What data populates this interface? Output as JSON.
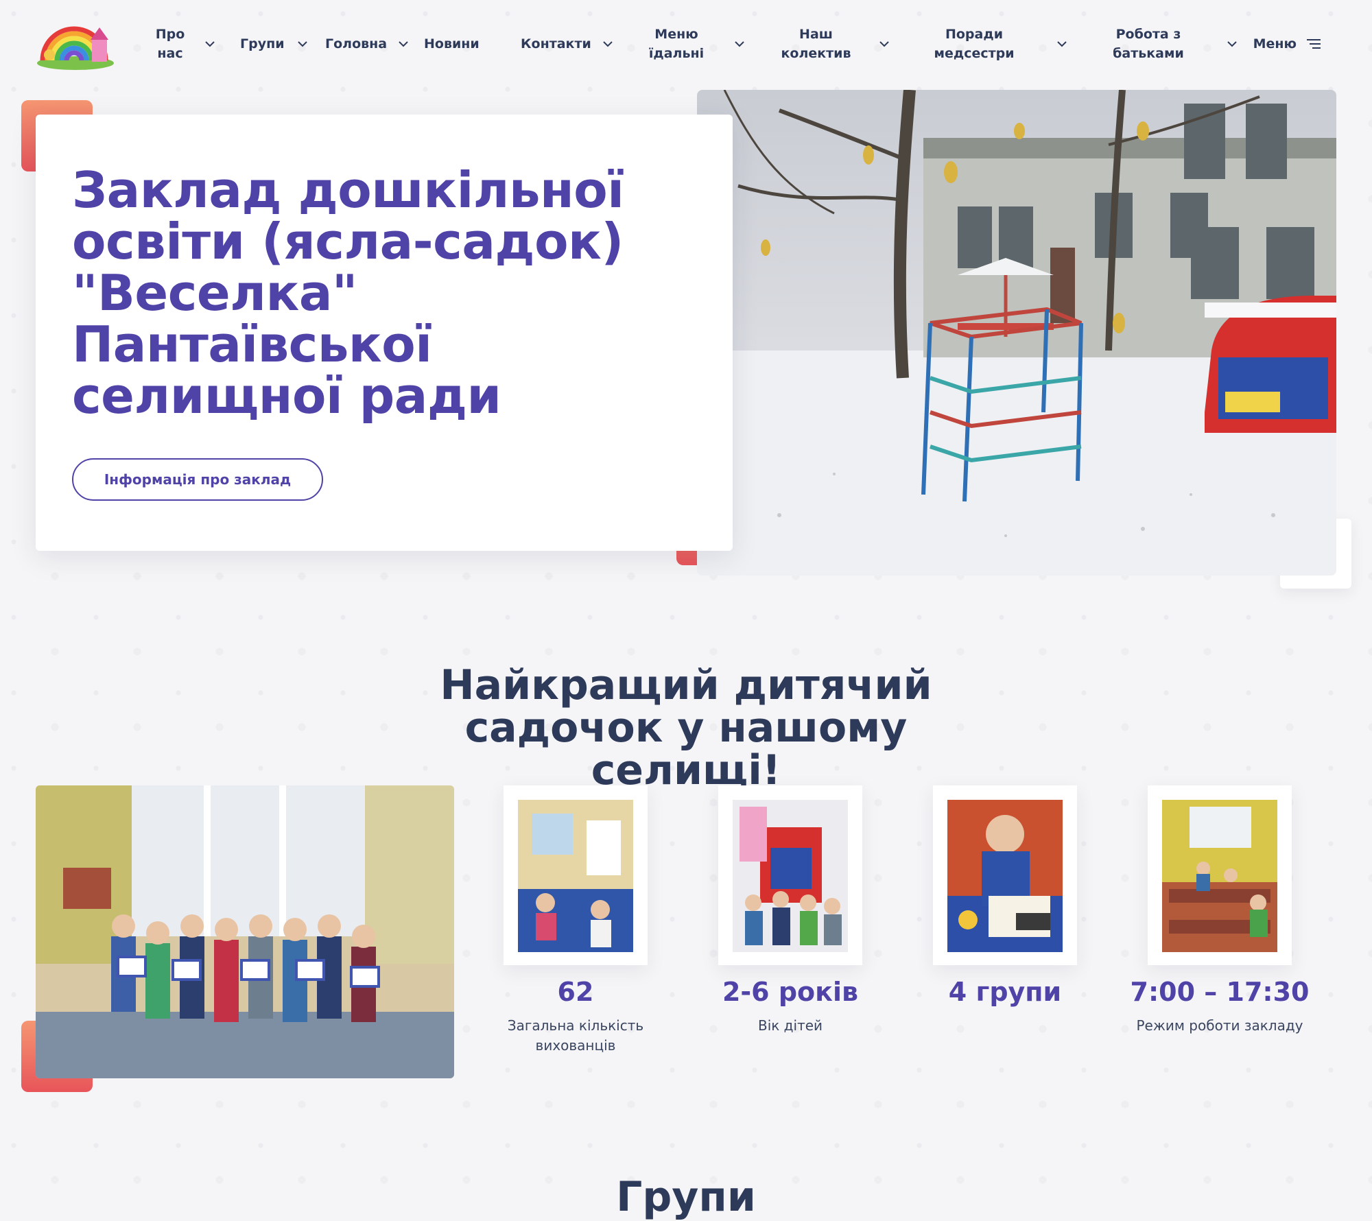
{
  "nav": {
    "items": [
      {
        "label": "Про нас",
        "has_dropdown": true
      },
      {
        "label": "Групи",
        "has_dropdown": true
      },
      {
        "label": "Головна",
        "has_dropdown": true
      },
      {
        "label": "Новини",
        "has_dropdown": false
      },
      {
        "label": "Контакти",
        "has_dropdown": true
      },
      {
        "label": "Меню їдальні",
        "has_dropdown": true
      },
      {
        "label": "Наш колектив",
        "has_dropdown": true
      },
      {
        "label": "Поради медсестри",
        "has_dropdown": true
      },
      {
        "label": "Робота з батьками",
        "has_dropdown": true
      }
    ],
    "menu_label": "Меню"
  },
  "hero": {
    "title": "Заклад дошкільної освіти (ясла-садок) \"Веселка\" Пантаївської селищної ради",
    "button_label": "Інформація про заклад"
  },
  "section": {
    "title": "Найкращий дитячий садочок у нашому селищі!",
    "stats": [
      {
        "value": "62",
        "label": "Загальна кількість вихованців"
      },
      {
        "value": "2-6 років",
        "label": "Вік дітей"
      },
      {
        "value": "4 групи",
        "label": ""
      },
      {
        "value": "7:00 – 17:30",
        "label": "Режим роботи закладу"
      }
    ]
  },
  "next_section": {
    "title": "Групи"
  },
  "colors": {
    "primary": "#4f43a8",
    "dark_text": "#2e3a59",
    "accent": "#ee6b5f",
    "background": "#f5f5f7"
  }
}
